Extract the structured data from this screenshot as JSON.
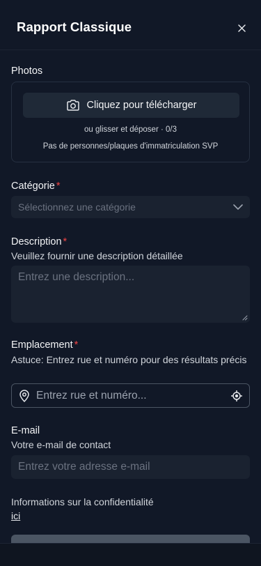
{
  "header": {
    "title": "Rapport Classique"
  },
  "photos": {
    "label": "Photos",
    "upload_label": "Cliquez pour télécharger",
    "hint": "ou glisser et déposer · 0/3",
    "note": "Pas de personnes/plaques d'immatriculation SVP"
  },
  "category": {
    "label": "Catégorie",
    "required": "*",
    "placeholder": "Sélectionnez une catégorie"
  },
  "description": {
    "label": "Description",
    "required": "*",
    "helper": "Veuillez fournir une description détaillée",
    "placeholder": "Entrez une description..."
  },
  "location": {
    "label": "Emplacement",
    "required": "*",
    "helper": "Astuce: Entrez rue et numéro pour des résultats précis",
    "placeholder": "Entrez rue et numéro..."
  },
  "email": {
    "label": "E-mail",
    "helper": "Votre e-mail de contact",
    "placeholder": "Entrez votre adresse e-mail"
  },
  "privacy": {
    "text": "Informations sur la confidentialité",
    "link": "ici"
  },
  "icons": {
    "close": "close-icon",
    "camera": "camera-icon",
    "chevron": "chevron-down-icon",
    "pin": "map-pin-icon",
    "locate": "crosshair-icon"
  },
  "colors": {
    "background": "#111827",
    "field": "#1a2230",
    "required": "#ef4444",
    "button_disabled": "#4b5563"
  }
}
